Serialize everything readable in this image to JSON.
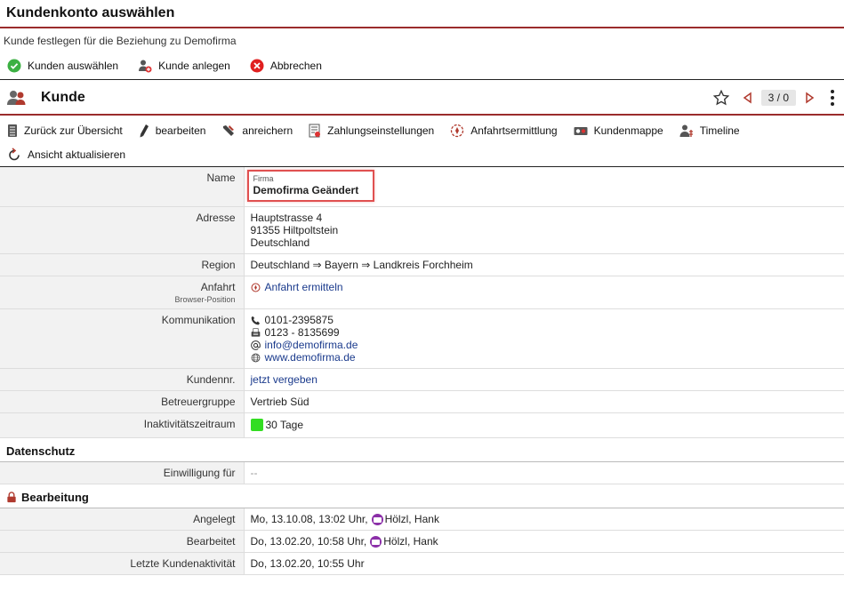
{
  "dialog": {
    "title": "Kundenkonto auswählen",
    "subtitle": "Kunde festlegen für die Beziehung zu Demofirma",
    "actions": {
      "select": "Kunden auswählen",
      "create": "Kunde anlegen",
      "cancel": "Abbrechen"
    }
  },
  "kunde": {
    "title": "Kunde",
    "pager": "3 / 0"
  },
  "toolbar": {
    "back": "Zurück zur Übersicht",
    "edit": "bearbeiten",
    "enrich": "anreichern",
    "payment": "Zahlungseinstellungen",
    "route": "Anfahrtsermittlung",
    "folder": "Kundenmappe",
    "timeline": "Timeline",
    "refresh": "Ansicht aktualisieren"
  },
  "fields": {
    "name": {
      "label": "Name",
      "type_label": "Firma",
      "value": "Demofirma Geändert"
    },
    "address": {
      "label": "Adresse",
      "lines": [
        "Hauptstrasse 4",
        "91355 Hiltpoltstein",
        "Deutschland"
      ]
    },
    "region": {
      "label": "Region",
      "value": "Deutschland ⇒ Bayern ⇒ Landkreis Forchheim"
    },
    "anfahrt": {
      "label": "Anfahrt",
      "sublabel": "Browser-Position",
      "value": "Anfahrt ermitteln"
    },
    "kommunikation": {
      "label": "Kommunikation",
      "phone": "0101-2395875",
      "fax": "0123 - 8135699",
      "email": "info@demofirma.de",
      "web": "www.demofirma.de"
    },
    "kundennr": {
      "label": "Kundennr.",
      "value": "jetzt vergeben"
    },
    "betreuer": {
      "label": "Betreuergruppe",
      "value": "Vertrieb Süd"
    },
    "inaktiv": {
      "label": "Inaktivitätszeitraum",
      "value": "30 Tage",
      "color": "#33dd22"
    }
  },
  "datenschutz": {
    "title": "Datenschutz",
    "einwilligung": {
      "label": "Einwilligung für",
      "value": "--"
    }
  },
  "bearbeitung": {
    "title": "Bearbeitung",
    "angelegt": {
      "label": "Angelegt",
      "value": "Mo, 13.10.08, 13:02 Uhr,",
      "user": "Hölzl, Hank"
    },
    "bearbeitet": {
      "label": "Bearbeitet",
      "value": "Do, 13.02.20, 10:58 Uhr,",
      "user": "Hölzl, Hank"
    },
    "letzte": {
      "label": "Letzte Kundenaktivität",
      "value": "Do, 13.02.20, 10:55 Uhr"
    }
  },
  "colors": {
    "accent": "#9b2c2c",
    "link": "#1a3a8c",
    "highlight": "#e05050"
  }
}
